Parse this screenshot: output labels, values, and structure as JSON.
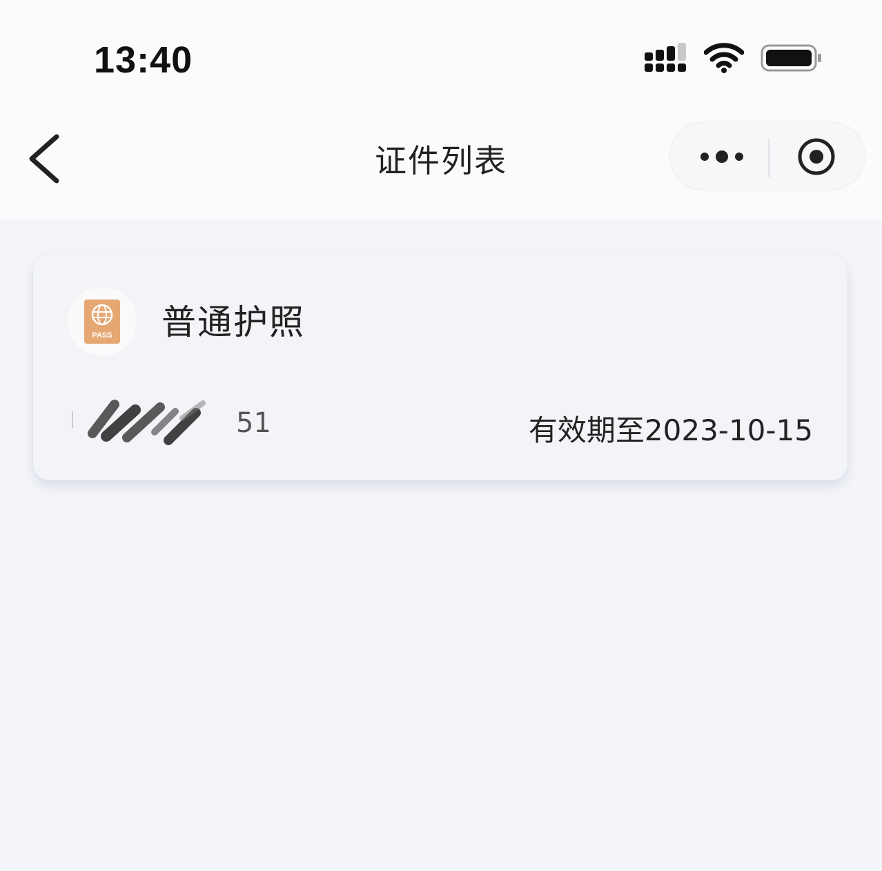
{
  "status_bar": {
    "time": "13:40",
    "icons": [
      "signal-icon",
      "wifi-icon",
      "battery-icon"
    ]
  },
  "nav_bar": {
    "title": "证件列表",
    "back_icon": "chevron-left-icon",
    "more_icon": "more-dots-icon",
    "close_icon": "target-circle-icon"
  },
  "card": {
    "icon": "passport-icon",
    "icon_text": "PASS",
    "title": "普通护照",
    "number_visible": "51",
    "expiry": "有效期至2023-10-15"
  },
  "colors": {
    "page_bg": "#f4f5f8",
    "card_bg": "#f3f4f8",
    "passport_orange": "#e6a873"
  }
}
